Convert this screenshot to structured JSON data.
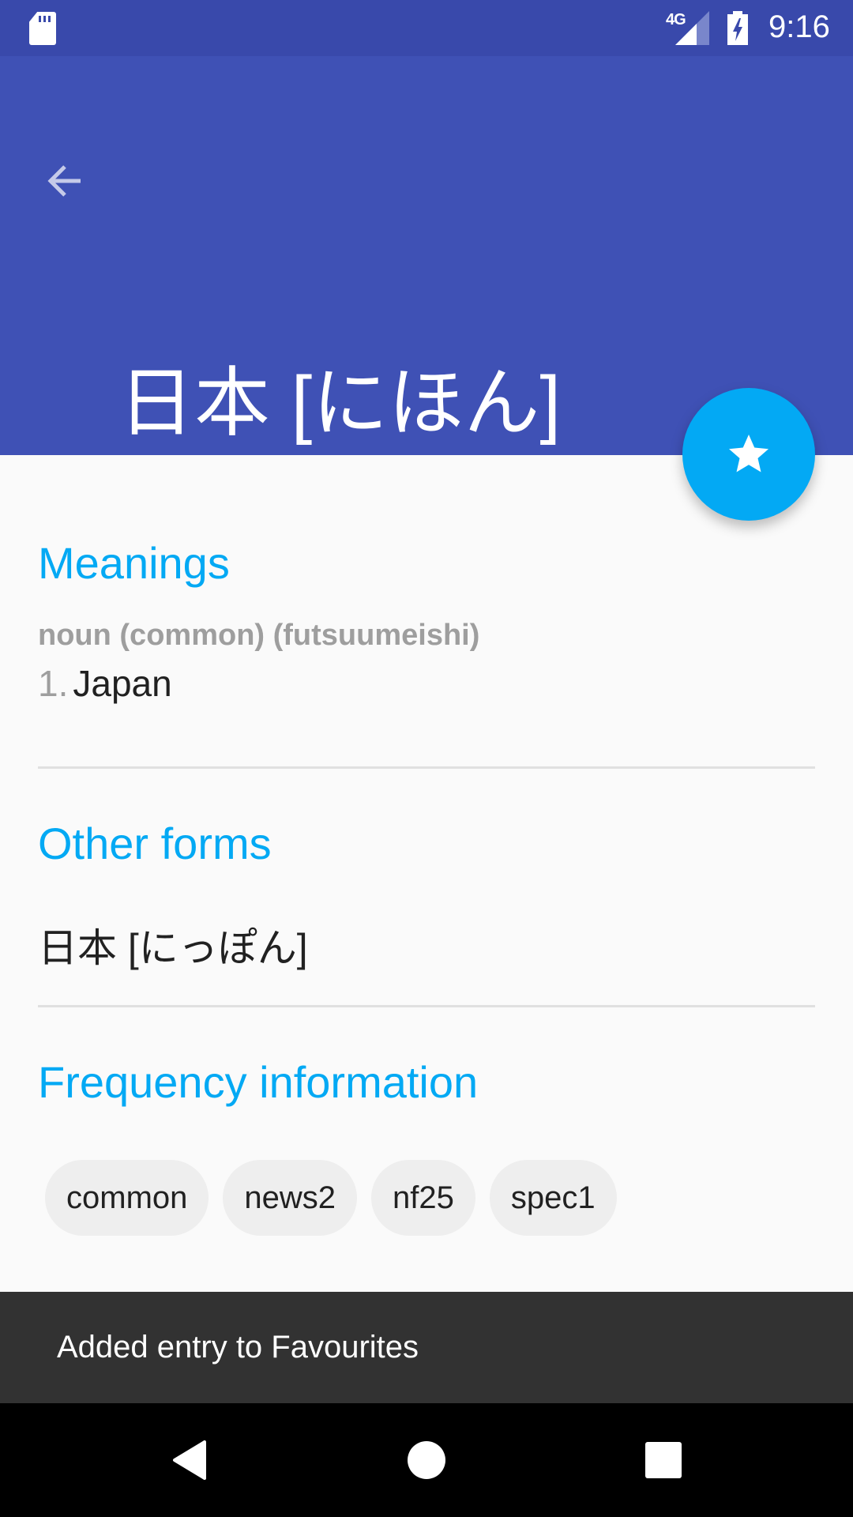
{
  "status_bar": {
    "network_label": "4G",
    "time": "9:16",
    "icons": [
      "sd-card-icon",
      "signal-icon",
      "battery-charging-icon"
    ]
  },
  "app_bar": {
    "back_icon": "arrow-left-icon",
    "title": "日本 [にほん]"
  },
  "fab": {
    "icon": "star-icon",
    "state": "favourited"
  },
  "sections": {
    "meanings": {
      "title": "Meanings",
      "part_of_speech": "noun (common) (futsuumeishi)",
      "items": [
        {
          "number": "1.",
          "text": "Japan"
        }
      ]
    },
    "other_forms": {
      "title": "Other forms",
      "items": [
        "日本 [にっぽん]"
      ]
    },
    "frequency": {
      "title": "Frequency information",
      "tags": [
        "common",
        "news2",
        "nf25",
        "spec1"
      ]
    }
  },
  "snackbar": {
    "message": "Added entry to Favourites"
  },
  "nav_bar": {
    "buttons": [
      "back",
      "home",
      "recents"
    ]
  },
  "colors": {
    "primary": "#3f51b5",
    "primary_dark": "#3949ab",
    "accent": "#03a9f4",
    "snackbar_bg": "#323232"
  }
}
